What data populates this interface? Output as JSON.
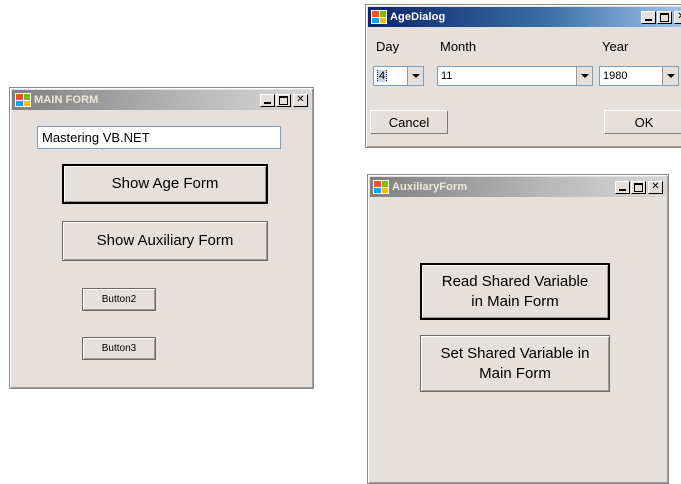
{
  "main_form": {
    "title": "MAIN FORM",
    "textbox_value": "Mastering VB.NET",
    "show_age_button": "Show Age Form",
    "show_auxiliary_button": "Show Auxiliary Form",
    "button2": "Button2",
    "button3": "Button3"
  },
  "age_dialog": {
    "title": "AgeDialog",
    "day_label": "Day",
    "month_label": "Month",
    "year_label": "Year",
    "day_value": "4",
    "month_value": "11",
    "year_value": "1980",
    "cancel_button": "Cancel",
    "ok_button": "OK"
  },
  "auxiliary_form": {
    "title": "AuxiliaryForm",
    "read_button": "Read Shared Variable in Main Form",
    "set_button": "Set Shared Variable in Main Form"
  },
  "colors": {
    "window_bg": "#e6e0dc",
    "active_title_start": "#0a246a",
    "inactive_title_start": "#808080"
  },
  "icons": [
    "app-icon",
    "minimize-icon",
    "maximize-icon",
    "close-icon",
    "dropdown-arrow-icon"
  ]
}
